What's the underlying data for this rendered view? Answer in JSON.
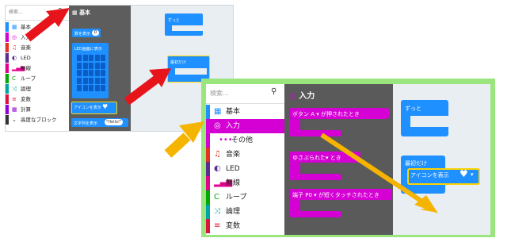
{
  "small": {
    "search_placeholder": "検索...",
    "flyout_title": "基本",
    "categories": [
      {
        "label": "基本",
        "icon": "▦",
        "color": "#1e90ff"
      },
      {
        "label": "入力",
        "icon": "◎",
        "color": "#d400d4"
      },
      {
        "label": "音楽",
        "icon": "♫",
        "color": "#e63022"
      },
      {
        "label": "LED",
        "icon": "◐",
        "color": "#5c2d91"
      },
      {
        "label": "無線",
        "icon": "▂▄▆",
        "color": "#e3008c"
      },
      {
        "label": "ループ",
        "icon": "C",
        "color": "#00aa00"
      },
      {
        "label": "論理",
        "icon": "⤨",
        "color": "#00a4a6"
      },
      {
        "label": "変数",
        "icon": "≡",
        "color": "#dc143c"
      },
      {
        "label": "計算",
        "icon": "▦",
        "color": "#9400d3"
      },
      {
        "label": "高度なブロック",
        "icon": "⌄",
        "color": "#333333"
      }
    ],
    "blocks": {
      "show_number": "数を表示",
      "show_number_value": "0",
      "show_leds": "LED画面に表示",
      "show_icon": "アイコンを表示",
      "show_string": "文字列を表示",
      "show_string_value": "\"Hello!\""
    },
    "workspace": {
      "forever": "ずっと",
      "on_start": "最初だけ"
    }
  },
  "big": {
    "search_placeholder": "検索...",
    "flyout_title": "入力",
    "categories": [
      {
        "label": "基本",
        "icon": "▦",
        "color": "#1e90ff"
      },
      {
        "label": "入力",
        "icon": "◎",
        "color": "#d400d4"
      },
      {
        "label": "その他",
        "icon": "•••",
        "color": "#d400d4"
      },
      {
        "label": "音楽",
        "icon": "♫",
        "color": "#e63022"
      },
      {
        "label": "LED",
        "icon": "◐",
        "color": "#5c2d91"
      },
      {
        "label": "無線",
        "icon": "▂▄▆",
        "color": "#e3008c"
      },
      {
        "label": "ループ",
        "icon": "C",
        "color": "#00aa00"
      },
      {
        "label": "論理",
        "icon": "⤨",
        "color": "#00a4a6"
      },
      {
        "label": "変数",
        "icon": "≡",
        "color": "#dc143c"
      }
    ],
    "blocks": {
      "button_pressed": "ボタン A ▾ が押されたとき",
      "on_shake": "ゆさぶられた▾ とき",
      "pin_pressed": "端子 P0 ▾ が短くタッチされたとき"
    },
    "workspace": {
      "forever": "ずっと",
      "on_start": "最初だけ",
      "show_icon": "アイコンを表示"
    }
  },
  "colors": {
    "arrow_red": "#e8141b",
    "arrow_orange": "#f5b400",
    "frame_green": "#9be57f",
    "highlight_yellow": "#ffd400"
  }
}
